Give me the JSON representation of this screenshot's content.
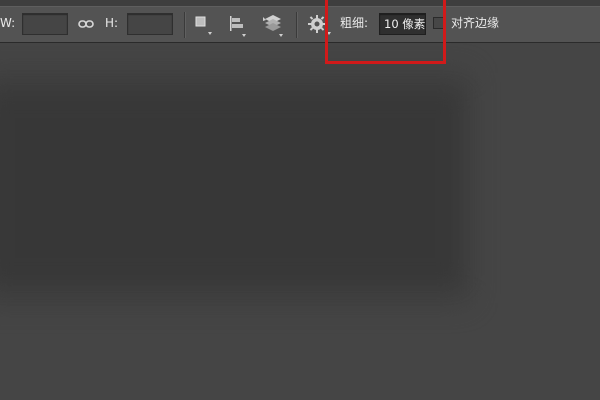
{
  "options_bar": {
    "width_label": "W:",
    "width_value": "",
    "height_label": "H:",
    "height_value": "",
    "stroke_label": "粗细:",
    "stroke_value": "10 像素",
    "align_edges_label": "对齐边缘",
    "align_edges_checked": false,
    "icons": [
      "link-icon",
      "path-operations-icon",
      "path-alignment-icon",
      "path-arrangement-icon",
      "gear-icon"
    ]
  },
  "highlight_color": "#d11a1a"
}
